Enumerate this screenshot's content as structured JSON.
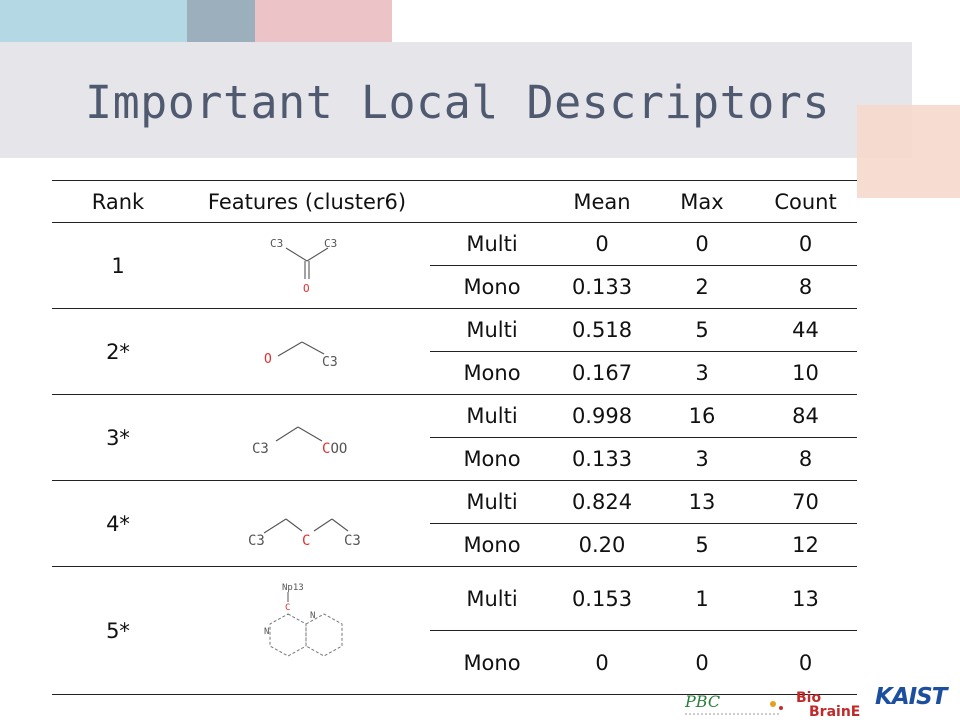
{
  "title": "Important Local Descriptors",
  "table": {
    "headers": {
      "rank": "Rank",
      "features": "Features (cluster6)",
      "type": "",
      "mean": "Mean",
      "max": "Max",
      "count": "Count"
    },
    "rows": [
      {
        "rank": "1",
        "molecule": {
          "left": "C3",
          "right": "C3",
          "bottom": "O"
        },
        "multi": {
          "label": "Multi",
          "mean": "0",
          "max": "0",
          "count": "0"
        },
        "mono": {
          "label": "Mono",
          "mean": "0.133",
          "max": "2",
          "count": "8"
        }
      },
      {
        "rank": "2*",
        "molecule": {
          "left": "O",
          "right": "C3"
        },
        "multi": {
          "label": "Multi",
          "mean": "0.518",
          "max": "5",
          "count": "44"
        },
        "mono": {
          "label": "Mono",
          "mean": "0.167",
          "max": "3",
          "count": "10"
        }
      },
      {
        "rank": "3*",
        "molecule": {
          "left": "C3",
          "right_c": "C",
          "right_rest": "OO"
        },
        "multi": {
          "label": "Multi",
          "mean": "0.998",
          "max": "16",
          "count": "84"
        },
        "mono": {
          "label": "Mono",
          "mean": "0.133",
          "max": "3",
          "count": "8"
        }
      },
      {
        "rank": "4*",
        "molecule": {
          "left": "C3",
          "center": "C",
          "right": "C3"
        },
        "multi": {
          "label": "Multi",
          "mean": "0.824",
          "max": "13",
          "count": "70"
        },
        "mono": {
          "label": "Mono",
          "mean": "0.20",
          "max": "5",
          "count": "12"
        }
      },
      {
        "rank": "5*",
        "molecule": {
          "top": "Np13",
          "center": "C",
          "n_left": "N",
          "n_right": "N"
        },
        "multi": {
          "label": "Multi",
          "mean": "0.153",
          "max": "1",
          "count": "13"
        },
        "mono": {
          "label": "Mono",
          "mean": "0",
          "max": "0",
          "count": "0"
        }
      }
    ]
  },
  "logos": {
    "pbc": "PBC",
    "bio": "Bio",
    "brain": "BrainE",
    "kaist": "KAIST"
  },
  "colors": {
    "title": "#4f5a70",
    "atom_red": "#e03030",
    "atom_gray": "#555555"
  }
}
